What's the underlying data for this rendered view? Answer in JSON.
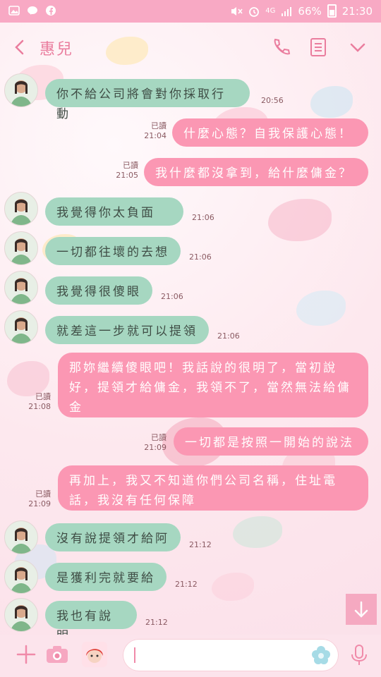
{
  "status_bar": {
    "battery": "66%",
    "time": "21:30",
    "network": "4G"
  },
  "header": {
    "title": "惠兒"
  },
  "messages": [
    {
      "dir": "in",
      "text": "你不給公司將會對你採取行動",
      "time": "20:56"
    },
    {
      "dir": "out",
      "text": "什麼心態？自我保護心態！",
      "read": "已讀",
      "time": "21:04"
    },
    {
      "dir": "out",
      "text": "我什麼都沒拿到，給什麼傭金？",
      "read": "已讀",
      "time": "21:05"
    },
    {
      "dir": "in",
      "text": "我覺得你太負面",
      "time": "21:06"
    },
    {
      "dir": "in",
      "text": "一切都往壞的去想",
      "time": "21:06"
    },
    {
      "dir": "in",
      "text": "我覺得很傻眼",
      "time": "21:06"
    },
    {
      "dir": "in",
      "text": "就差這一步就可以提領",
      "time": "21:06"
    },
    {
      "dir": "out",
      "text": "那妳繼續傻眼吧！我話說的很明了，當初說好，提領才給傭金，我領不了，當然無法給傭金",
      "read": "已讀",
      "time": "21:08"
    },
    {
      "dir": "out",
      "text": "一切都是按照一開始的說法",
      "read": "已讀",
      "time": "21:09"
    },
    {
      "dir": "out",
      "text": "再加上，我又不知道你們公司名稱，住址電話，我沒有任何保障",
      "read": "已讀",
      "time": "21:09"
    },
    {
      "dir": "in",
      "text": "沒有說提領才給阿",
      "time": "21:12"
    },
    {
      "dir": "in",
      "text": "是獲利完就要給",
      "time": "21:12"
    },
    {
      "dir": "in",
      "text": "我也有說明",
      "time": "21:12"
    }
  ],
  "colors": {
    "incoming_bubble": "#a6d7c1",
    "outgoing_bubble": "#fb97b3",
    "accent": "#ea7d9e"
  }
}
